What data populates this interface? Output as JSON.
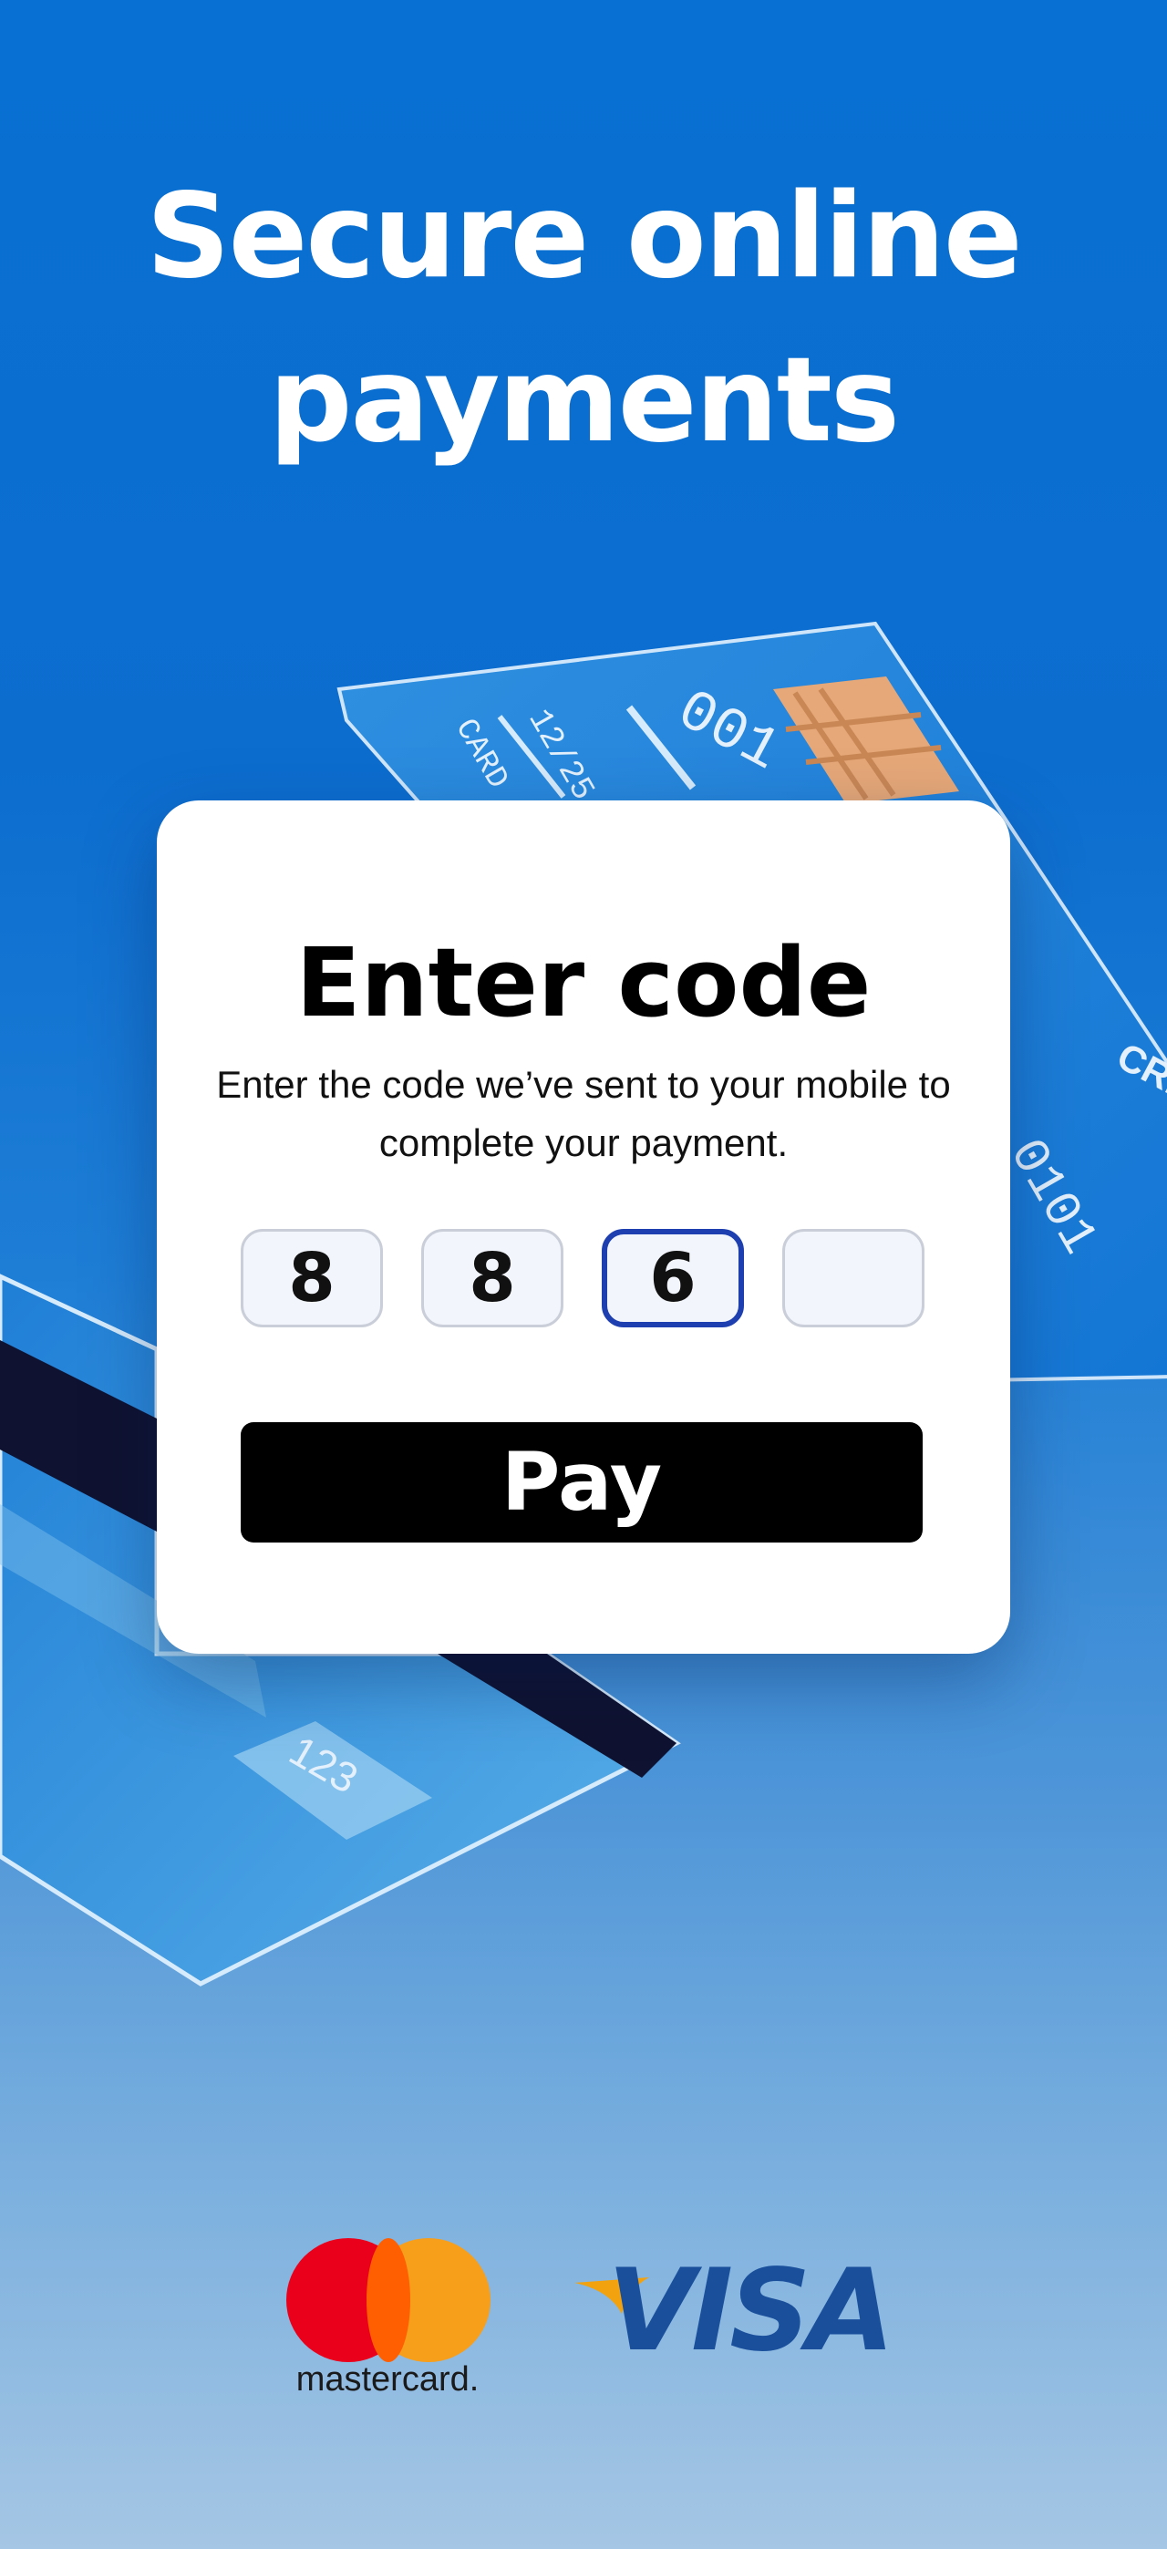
{
  "headline": {
    "line1": "Secure online",
    "line2": "payments"
  },
  "background_card_front": {
    "expiry_label": "12/25",
    "card_label": "CARD",
    "number_fragment": "001",
    "side_text": "CRE",
    "side_number": "0101"
  },
  "background_card_back": {
    "cvv": "123"
  },
  "modal": {
    "title": "Enter code",
    "description": "Enter the code we’ve sent to your mobile to complete your payment.",
    "digits": [
      "8",
      "8",
      "6",
      ""
    ],
    "active_digit_index": 2,
    "pay_label": "Pay"
  },
  "logos": {
    "mastercard_text": "mastercard.",
    "visa_text": "VISA"
  },
  "colors": {
    "background_top": "#0870d2",
    "background_bottom": "#a5c6e4",
    "active_border": "#1d3fb0",
    "button": "#000000",
    "mastercard_red": "#eb001b",
    "mastercard_yellow": "#f79e1b",
    "visa_blue": "#1a4f9c"
  }
}
